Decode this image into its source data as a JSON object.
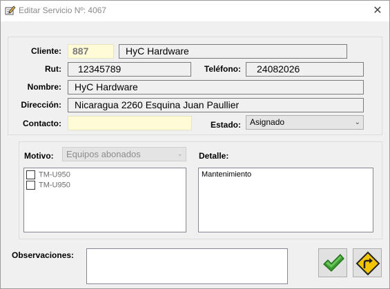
{
  "window": {
    "title": "Editar Servicio Nº: 4067",
    "title_icon": "pencil-form-icon",
    "close_icon": "close-icon",
    "close_glyph": "✕"
  },
  "cliente": {
    "label": "Cliente:",
    "codigo": "887",
    "nombre": "HyC Hardware"
  },
  "rut": {
    "label": "Rut:",
    "value": "12345789"
  },
  "telefono": {
    "label": "Teléfono:",
    "value": "24082026"
  },
  "nombre": {
    "label": "Nombre:",
    "value": "HyC Hardware"
  },
  "direccion": {
    "label": "Dirección:",
    "value": "Nicaragua 2260 Esquina Juan Paullier"
  },
  "contacto": {
    "label": "Contacto:",
    "value": ""
  },
  "estado": {
    "label": "Estado:",
    "selected": "Asignado",
    "chevron": "⌄"
  },
  "motivo": {
    "label": "Motivo:",
    "selected": "Equipos abonados",
    "chevron": "⌄",
    "items": [
      {
        "label": "TM-U950",
        "checked": false
      },
      {
        "label": "TM-U950",
        "checked": false
      }
    ]
  },
  "detalle": {
    "label": "Detalle:",
    "value": "Mantenimiento"
  },
  "observaciones": {
    "label": "Observaciones:",
    "value": ""
  },
  "buttons": {
    "accept_icon": "checkmark-icon",
    "cancel_icon": "turn-right-sign-icon"
  },
  "colors": {
    "field_yellow": "#fffbd6",
    "check_green": "#3a9b2e",
    "sign_yellow": "#f2c500"
  }
}
